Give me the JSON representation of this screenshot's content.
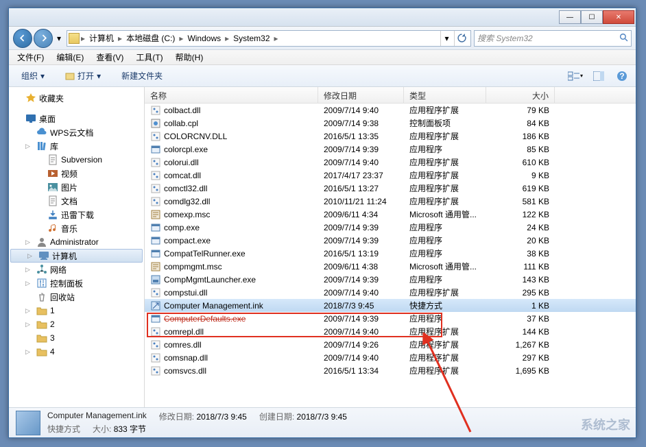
{
  "titlebar": {
    "min": "—",
    "max": "☐",
    "close": "✕"
  },
  "breadcrumbs": [
    {
      "label": "计算机"
    },
    {
      "label": "本地磁盘 (C:)"
    },
    {
      "label": "Windows"
    },
    {
      "label": "System32"
    }
  ],
  "search": {
    "placeholder": "搜索 System32"
  },
  "menus": [
    "文件(F)",
    "编辑(E)",
    "查看(V)",
    "工具(T)",
    "帮助(H)"
  ],
  "toolbar": {
    "org": "组织",
    "open": "打开",
    "new": "新建文件夹"
  },
  "tree": [
    {
      "indent": 0,
      "tw": "",
      "ic": "star",
      "label": "收藏夹",
      "color": "#e8b030"
    },
    {
      "indent": 0,
      "tw": "",
      "ic": "",
      "label": ""
    },
    {
      "indent": 0,
      "tw": "",
      "ic": "desktop",
      "label": "桌面",
      "color": "#3070b0"
    },
    {
      "indent": 1,
      "tw": "",
      "ic": "cloud",
      "label": "WPS云文档",
      "color": "#4a90d0"
    },
    {
      "indent": 1,
      "tw": "▷",
      "ic": "library",
      "label": "库",
      "color": "#4a90d0"
    },
    {
      "indent": 2,
      "tw": "",
      "ic": "doc",
      "label": "Subversion",
      "color": "#888"
    },
    {
      "indent": 2,
      "tw": "",
      "ic": "video",
      "label": "视频",
      "color": "#b86030"
    },
    {
      "indent": 2,
      "tw": "",
      "ic": "pic",
      "label": "图片",
      "color": "#4a90a0"
    },
    {
      "indent": 2,
      "tw": "",
      "ic": "doc",
      "label": "文档",
      "color": "#888"
    },
    {
      "indent": 2,
      "tw": "",
      "ic": "dl",
      "label": "迅雷下载",
      "color": "#4080c0"
    },
    {
      "indent": 2,
      "tw": "",
      "ic": "music",
      "label": "音乐",
      "color": "#d07030"
    },
    {
      "indent": 1,
      "tw": "▷",
      "ic": "user",
      "label": "Administrator",
      "color": "#888"
    },
    {
      "indent": 1,
      "tw": "▷",
      "ic": "computer",
      "label": "计算机",
      "color": "#6090c0",
      "sel": true
    },
    {
      "indent": 1,
      "tw": "▷",
      "ic": "network",
      "label": "网络",
      "color": "#4a90a0"
    },
    {
      "indent": 1,
      "tw": "▷",
      "ic": "control",
      "label": "控制面板",
      "color": "#4080c0"
    },
    {
      "indent": 1,
      "tw": "",
      "ic": "recycle",
      "label": "回收站",
      "color": "#888"
    },
    {
      "indent": 1,
      "tw": "▷",
      "ic": "folder",
      "label": "1",
      "color": "#e8c060"
    },
    {
      "indent": 1,
      "tw": "▷",
      "ic": "folder",
      "label": "2",
      "color": "#e8c060"
    },
    {
      "indent": 1,
      "tw": "",
      "ic": "folder",
      "label": "3",
      "color": "#e8c060"
    },
    {
      "indent": 1,
      "tw": "▷",
      "ic": "folder",
      "label": "4",
      "color": "#e8c060"
    }
  ],
  "columns": {
    "name": "名称",
    "date": "修改日期",
    "type": "类型",
    "size": "大小"
  },
  "files": [
    {
      "n": "colbact.dll",
      "d": "2009/7/14 9:40",
      "t": "应用程序扩展",
      "s": "79 KB",
      "ic": "dll"
    },
    {
      "n": "collab.cpl",
      "d": "2009/7/14 9:38",
      "t": "控制面板项",
      "s": "84 KB",
      "ic": "cpl"
    },
    {
      "n": "COLORCNV.DLL",
      "d": "2016/5/1 13:35",
      "t": "应用程序扩展",
      "s": "186 KB",
      "ic": "dll"
    },
    {
      "n": "colorcpl.exe",
      "d": "2009/7/14 9:39",
      "t": "应用程序",
      "s": "85 KB",
      "ic": "exe"
    },
    {
      "n": "colorui.dll",
      "d": "2009/7/14 9:40",
      "t": "应用程序扩展",
      "s": "610 KB",
      "ic": "dll"
    },
    {
      "n": "comcat.dll",
      "d": "2017/4/17 23:37",
      "t": "应用程序扩展",
      "s": "9 KB",
      "ic": "dll"
    },
    {
      "n": "comctl32.dll",
      "d": "2016/5/1 13:27",
      "t": "应用程序扩展",
      "s": "619 KB",
      "ic": "dll"
    },
    {
      "n": "comdlg32.dll",
      "d": "2010/11/21 11:24",
      "t": "应用程序扩展",
      "s": "581 KB",
      "ic": "dll"
    },
    {
      "n": "comexp.msc",
      "d": "2009/6/11 4:34",
      "t": "Microsoft 通用管...",
      "s": "122 KB",
      "ic": "msc"
    },
    {
      "n": "comp.exe",
      "d": "2009/7/14 9:39",
      "t": "应用程序",
      "s": "24 KB",
      "ic": "exe"
    },
    {
      "n": "compact.exe",
      "d": "2009/7/14 9:39",
      "t": "应用程序",
      "s": "20 KB",
      "ic": "exe"
    },
    {
      "n": "CompatTelRunner.exe",
      "d": "2016/5/1 13:19",
      "t": "应用程序",
      "s": "38 KB",
      "ic": "exe"
    },
    {
      "n": "compmgmt.msc",
      "d": "2009/6/11 4:38",
      "t": "Microsoft 通用管...",
      "s": "111 KB",
      "ic": "msc"
    },
    {
      "n": "CompMgmtLauncher.exe",
      "d": "2009/7/14 9:39",
      "t": "应用程序",
      "s": "143 KB",
      "ic": "exe2"
    },
    {
      "n": "compstui.dll",
      "d": "2009/7/14 9:40",
      "t": "应用程序扩展",
      "s": "295 KB",
      "ic": "dll"
    },
    {
      "n": "Computer Management.ink",
      "d": "2018/7/3 9:45",
      "t": "快捷方式",
      "s": "1 KB",
      "ic": "lnk",
      "sel": true
    },
    {
      "n": "ComputerDefaults.exe",
      "d": "2009/7/14 9:39",
      "t": "应用程序",
      "s": "37 KB",
      "ic": "exe",
      "strike": true
    },
    {
      "n": "comrepl.dll",
      "d": "2009/7/14 9:40",
      "t": "应用程序扩展",
      "s": "144 KB",
      "ic": "dll"
    },
    {
      "n": "comres.dll",
      "d": "2009/7/14 9:26",
      "t": "应用程序扩展",
      "s": "1,267 KB",
      "ic": "dll"
    },
    {
      "n": "comsnap.dll",
      "d": "2009/7/14 9:40",
      "t": "应用程序扩展",
      "s": "297 KB",
      "ic": "dll"
    },
    {
      "n": "comsvcs.dll",
      "d": "2016/5/1 13:34",
      "t": "应用程序扩展",
      "s": "1,695 KB",
      "ic": "dll"
    }
  ],
  "status": {
    "name": "Computer Management.ink",
    "type": "快捷方式",
    "mod_label": "修改日期:",
    "mod": "2018/7/3 9:45",
    "size_label": "大小:",
    "size": "833 字节",
    "created_label": "创建日期:",
    "created": "2018/7/3 9:45"
  },
  "watermark": "系统之家"
}
